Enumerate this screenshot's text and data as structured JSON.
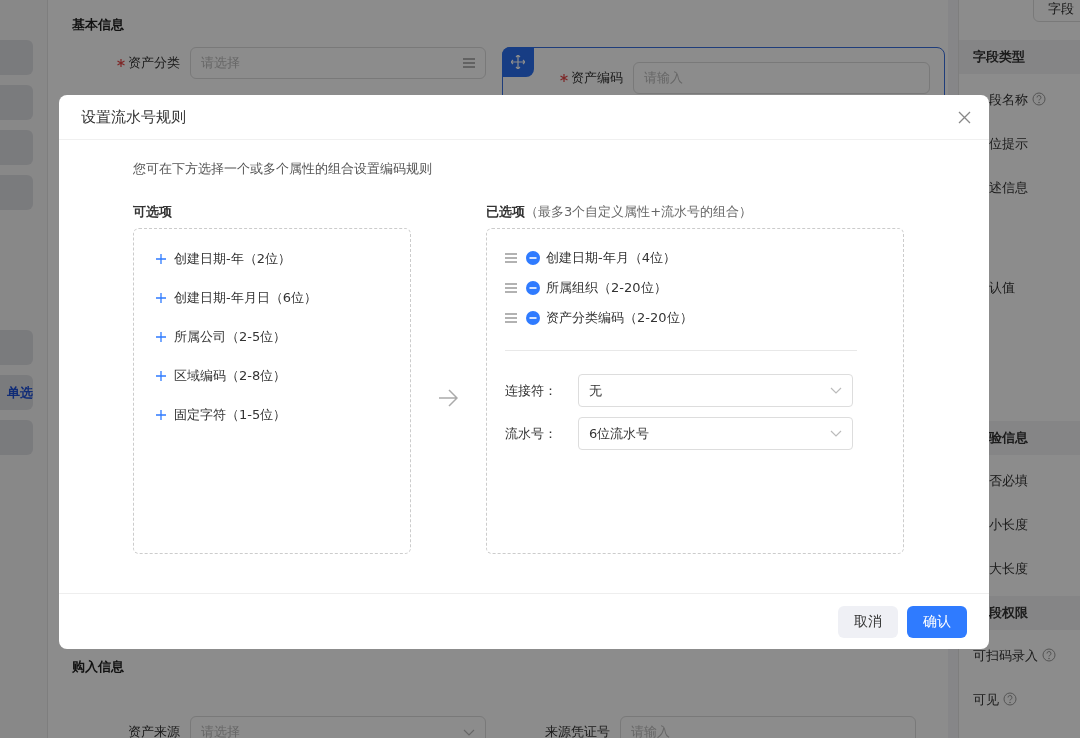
{
  "sidebar": {
    "items": [
      {
        "label": "单选",
        "selected": true
      }
    ]
  },
  "form": {
    "sections": [
      {
        "title": "基本信息",
        "fields": [
          {
            "label": "资产分类",
            "required": true,
            "kind": "picker",
            "placeholder": "请选择",
            "selected": false
          },
          {
            "label": "资产编码",
            "required": true,
            "kind": "input",
            "placeholder": "请输入",
            "selected": true
          }
        ]
      },
      {
        "title": "购入信息",
        "fields": [
          {
            "label": "资产来源",
            "required": false,
            "kind": "select",
            "placeholder": "请选择",
            "selected": false
          },
          {
            "label": "来源凭证号",
            "required": false,
            "kind": "input",
            "placeholder": "请输入",
            "selected": false
          }
        ]
      }
    ]
  },
  "right_panel": {
    "top_button": "字段",
    "sections": [
      {
        "title": "字段类型",
        "clipped": false,
        "rows": [
          {
            "label": "段名称",
            "help": true,
            "clipped": true,
            "kind": "line"
          },
          {
            "label": "位提示",
            "help": false,
            "clipped": true,
            "kind": "line"
          },
          {
            "label": "述信息",
            "help": false,
            "clipped": true,
            "kind": "textarea"
          },
          {
            "label": "认值",
            "help": false,
            "clipped": true,
            "kind": "block"
          }
        ]
      },
      {
        "title": "验信息",
        "clipped": true,
        "rows": [
          {
            "label": "否必填",
            "help": false,
            "clipped": true,
            "kind": "line"
          },
          {
            "label": "小长度",
            "help": false,
            "clipped": true,
            "kind": "line"
          },
          {
            "label": "大长度",
            "help": false,
            "clipped": true,
            "kind": "line"
          }
        ]
      },
      {
        "title": "段权限",
        "clipped": true,
        "rows": [
          {
            "label": "可扫码录入",
            "help": true,
            "clipped": false,
            "kind": "line"
          },
          {
            "label": "可见",
            "help": true,
            "clipped": false,
            "kind": "line"
          }
        ]
      }
    ]
  },
  "dialog": {
    "title": "设置流水号规则",
    "description": "您可在下方选择一个或多个属性的组合设置编码规则",
    "available": {
      "title": "可选项",
      "items": [
        "创建日期-年（2位）",
        "创建日期-年月日（6位）",
        "所属公司（2-5位）",
        "区域编码（2-8位）",
        "固定字符（1-5位）"
      ]
    },
    "chosen": {
      "title": "已选项",
      "note": "（最多3个自定义属性+流水号的组合）",
      "items": [
        "创建日期-年月（4位）",
        "所属组织（2-20位）",
        "资产分类编码（2-20位）"
      ]
    },
    "settings": [
      {
        "label": "连接符：",
        "value": "无"
      },
      {
        "label": "流水号：",
        "value": "6位流水号"
      }
    ],
    "buttons": [
      {
        "label": "取消",
        "kind": "secondary"
      },
      {
        "label": "确认",
        "kind": "primary"
      }
    ]
  }
}
